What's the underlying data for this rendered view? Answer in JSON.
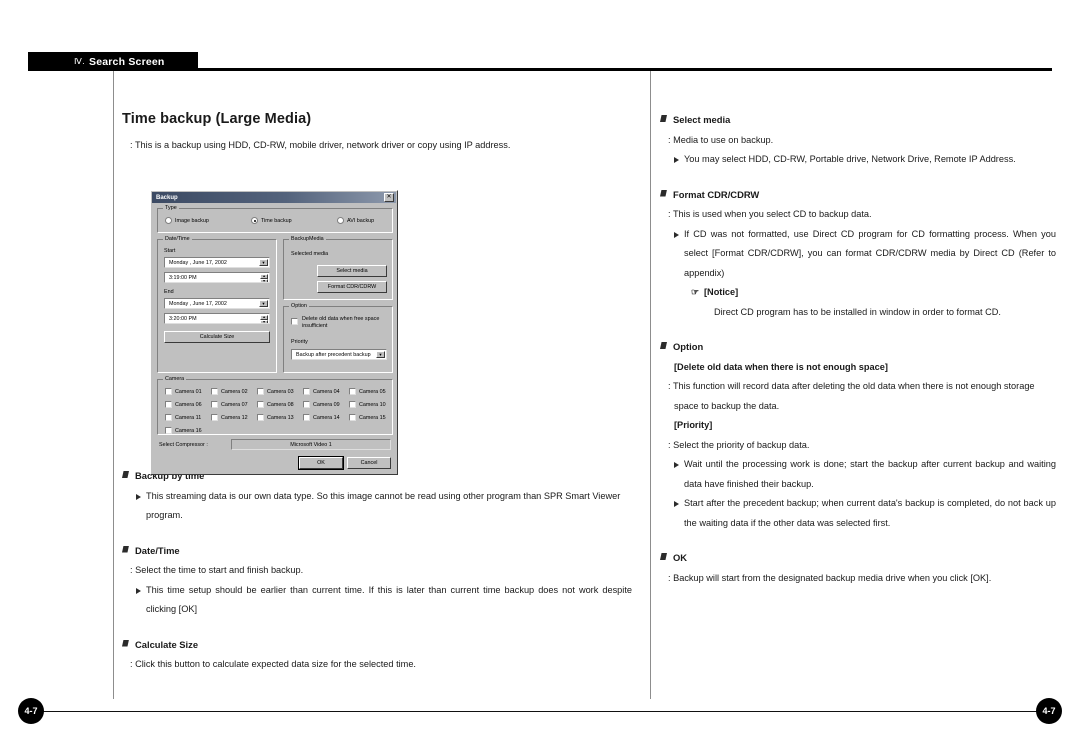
{
  "header": {
    "numeral": "Ⅳ.",
    "title": "Search Screen"
  },
  "page_number": "4-7",
  "left_column": {
    "title": "Time backup (Large Media)",
    "intro": ": This is a backup using HDD, CD-RW, mobile driver, network driver or  copy using IP address.",
    "sections": [
      {
        "heading": "Backup by time",
        "bullet": "This streaming data is our own data type. So this image cannot be read using other program than SPR Smart Viewer program."
      },
      {
        "heading": "Date/Time",
        "colon": ": Select the time to start and finish backup.",
        "bullet": "This time setup should be earlier than current time. If this is later than current time backup does not work despite clicking [OK]"
      },
      {
        "heading": "Calculate Size",
        "colon": ": Click this button to calculate expected data size for the selected time."
      }
    ]
  },
  "right_column": {
    "select_media": {
      "heading": "Select media",
      "colon": ": Media to use on backup.",
      "bullet": "You may select HDD, CD-RW, Portable drive, Network Drive, Remote IP Address."
    },
    "format": {
      "heading": "Format CDR/CDRW",
      "colon": ": This is used when you select CD to backup data.",
      "bullet": "If CD was not formatted, use Direct CD program for CD formatting process. When you select [Format CDR/CDRW], you can format CDR/CDRW media by Direct CD (Refer to appendix)",
      "notice_label": "[Notice]",
      "notice_icon": "☞",
      "notice_body": "Direct CD program has to be installed in  window in order to format CD."
    },
    "option": {
      "heading": "Option",
      "delete_label": "[Delete old data when there is not enough space]",
      "delete_body": ": This function will record data after deleting the old data when there is not enough storage space to backup the data.",
      "priority_label": "[Priority]",
      "priority_colon": ": Select the priority of backup data.",
      "bullet1": "Wait until the processing work is done; start the backup after current backup and waiting data have finished their backup.",
      "bullet2": "Start after the precedent backup; when current data's backup is completed, do not back up the waiting data if the other data was selected first."
    },
    "ok": {
      "heading": "OK",
      "colon": ": Backup will start from the designated backup media drive when you click [OK]."
    }
  },
  "dialog": {
    "title": "Backup",
    "close_glyph": "✕",
    "type_group": {
      "legend": "Type",
      "options": [
        {
          "label": "Image backup",
          "selected": false
        },
        {
          "label": "Time backup",
          "selected": true
        },
        {
          "label": "AVI backup",
          "selected": false
        }
      ]
    },
    "datetime_group": {
      "legend": "Date/Time",
      "start_label": "Start",
      "start_date": "Monday  ,   June    17, 2002",
      "start_time": "3:19:00 PM",
      "end_label": "End",
      "end_date": "Monday  ,   June    17, 2002",
      "end_time": "3:20:00 PM",
      "calculate_button": "Calculate Size"
    },
    "media_group": {
      "legend": "BackupMedia",
      "selected_media_label": "Selected media",
      "select_media_button": "Select media",
      "format_button": "Format CDR/CDRW"
    },
    "option_group": {
      "legend": "Option",
      "checkbox_label": "Delete old data when free space insufficient",
      "checkbox_checked": false,
      "priority_label": "Priority",
      "priority_value": "Backup after precedent backup"
    },
    "camera_group": {
      "legend": "Camera",
      "cameras": [
        "Camera 01",
        "Camera 02",
        "Camera 03",
        "Camera 04",
        "Camera 05",
        "Camera 06",
        "Camera 07",
        "Camera 08",
        "Camera 09",
        "Camera 10",
        "Camera 11",
        "Camera 12",
        "Camera 13",
        "Camera 14",
        "Camera 15",
        "Camera 16"
      ]
    },
    "compressor": {
      "label": "Select Compressor :",
      "value": "Microsoft Video 1"
    },
    "ok_button": "OK",
    "cancel_button": "Cancel"
  }
}
